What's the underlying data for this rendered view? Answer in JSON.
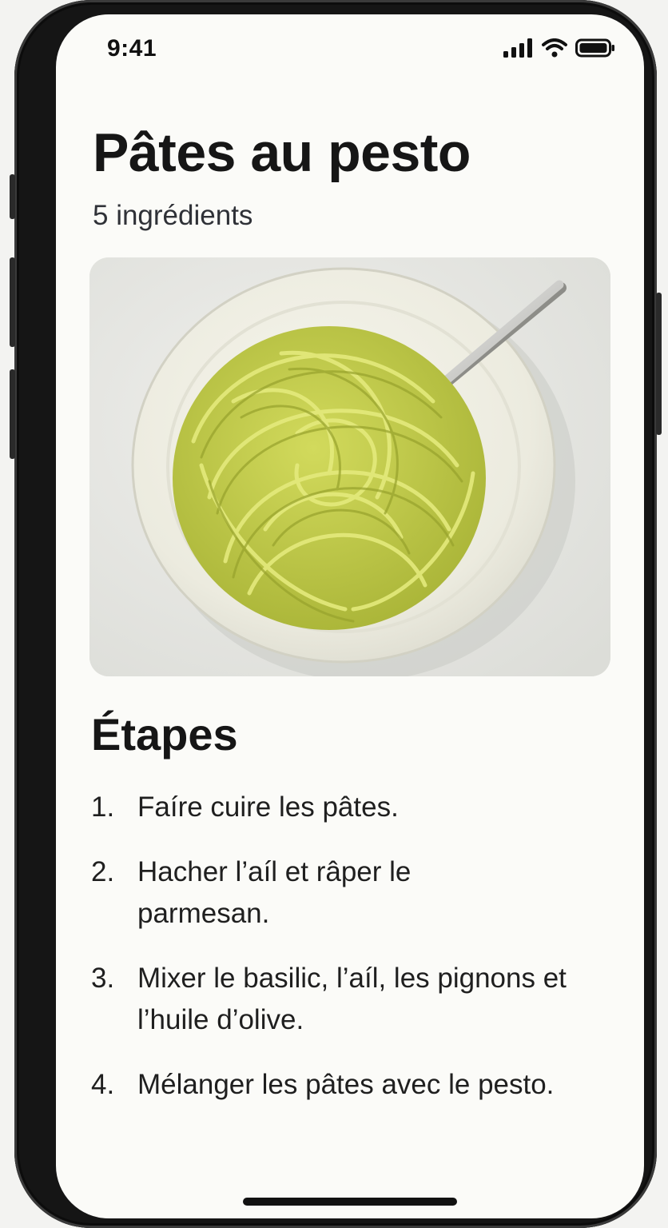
{
  "status_bar": {
    "time": "9:41",
    "icons": [
      "cellular-signal-icon",
      "wifi-icon",
      "battery-icon"
    ]
  },
  "recipe": {
    "title": "Pâtes au pesto",
    "subtitle": "5 ingrédients",
    "photo_alt": "Bol de pâtes au pesto avec une fourchette"
  },
  "steps_section": {
    "heading": "Étapes",
    "steps": [
      {
        "number": "1.",
        "text": "Faíre cuire les pâtes."
      },
      {
        "number": "2.",
        "text": "Hacher l’aíl et râper le parmesan."
      },
      {
        "number": "3.",
        "text": "Mixer le basilic, l’aíl, les pignons et l’huile d’olive."
      },
      {
        "number": "4.",
        "text": "Mélanger les pâtes avec le pesto."
      }
    ]
  },
  "colors": {
    "background": "#fbfbf8",
    "text": "#161616",
    "pesto": "#c2cc48"
  }
}
